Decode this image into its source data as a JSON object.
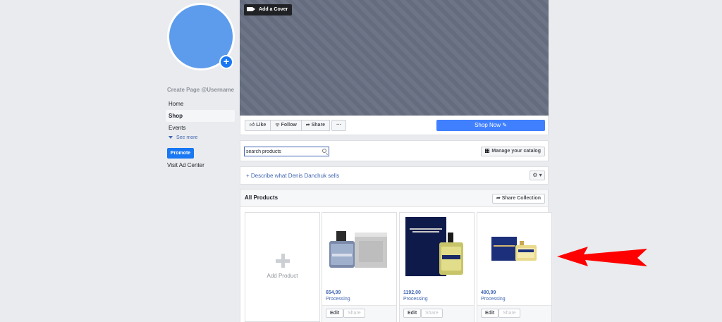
{
  "sidebar": {
    "create_page": "Create Page @Username",
    "items": [
      {
        "label": "Home"
      },
      {
        "label": "Shop"
      },
      {
        "label": "Events"
      }
    ],
    "see_more": "See more",
    "promote": "Promote",
    "visit_ad_center": "Visit Ad Center"
  },
  "cover": {
    "add_cover": "Add a Cover"
  },
  "actions": {
    "like": "Like",
    "follow": "Follow",
    "share": "Share",
    "more": "···",
    "shop_now": "Shop Now ✎"
  },
  "search": {
    "value": "search products",
    "manage_catalog": "Manage your catalog"
  },
  "describe": {
    "text": "+ Describe what Denis Danchuk sells",
    "settings": "⚙ ▾"
  },
  "products": {
    "title": "All Products",
    "share_collection": "Share Collection",
    "add_product": "Add Product",
    "items": [
      {
        "price": "654,99",
        "status": "Processing",
        "edit": "Edit",
        "share": "Share"
      },
      {
        "price": "1192,00",
        "status": "Processing",
        "edit": "Edit",
        "share": "Share"
      },
      {
        "price": "490,99",
        "status": "Processing",
        "edit": "Edit",
        "share": "Share"
      }
    ]
  },
  "colors": {
    "accent": "#1877f2",
    "link": "#4267b2",
    "annotation_arrow": "#ff0000"
  }
}
